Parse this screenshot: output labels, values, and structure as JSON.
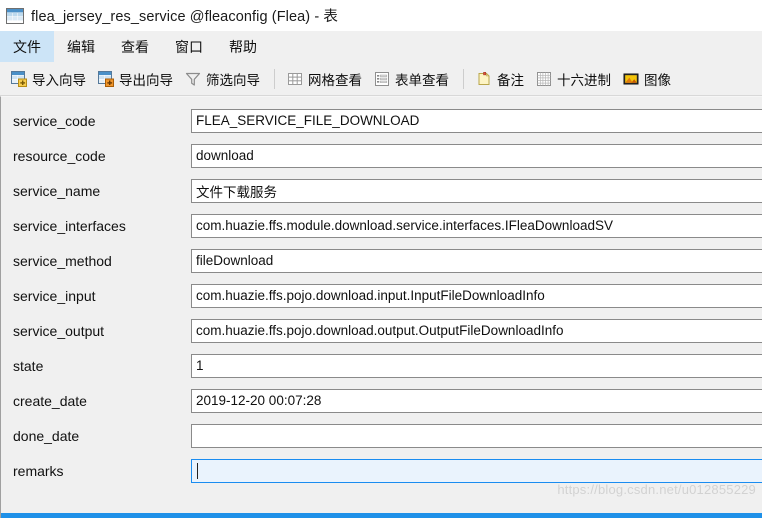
{
  "window": {
    "title": "flea_jersey_res_service @fleaconfig (Flea) - 表",
    "icon": "table-icon"
  },
  "menubar": {
    "items": [
      {
        "label": "文件",
        "active": true
      },
      {
        "label": "编辑",
        "active": false
      },
      {
        "label": "查看",
        "active": false
      },
      {
        "label": "窗口",
        "active": false
      },
      {
        "label": "帮助",
        "active": false
      }
    ]
  },
  "toolbar": {
    "groups": [
      {
        "buttons": [
          {
            "label": "导入向导",
            "icon": "import-wizard-icon"
          },
          {
            "label": "导出向导",
            "icon": "export-wizard-icon"
          },
          {
            "label": "筛选向导",
            "icon": "filter-wizard-icon"
          }
        ]
      },
      {
        "buttons": [
          {
            "label": "网格查看",
            "icon": "grid-view-icon"
          },
          {
            "label": "表单查看",
            "icon": "form-view-icon"
          }
        ]
      },
      {
        "buttons": [
          {
            "label": "备注",
            "icon": "memo-icon"
          },
          {
            "label": "十六进制",
            "icon": "hex-icon"
          },
          {
            "label": "图像",
            "icon": "image-icon"
          }
        ]
      }
    ]
  },
  "form": {
    "fields": [
      {
        "label": "service_code",
        "value": "FLEA_SERVICE_FILE_DOWNLOAD",
        "focused": false
      },
      {
        "label": "resource_code",
        "value": "download",
        "focused": false
      },
      {
        "label": "service_name",
        "value": "文件下载服务",
        "focused": false
      },
      {
        "label": "service_interfaces",
        "value": "com.huazie.ffs.module.download.service.interfaces.IFleaDownloadSV",
        "focused": false
      },
      {
        "label": "service_method",
        "value": "fileDownload",
        "focused": false
      },
      {
        "label": "service_input",
        "value": "com.huazie.ffs.pojo.download.input.InputFileDownloadInfo",
        "focused": false
      },
      {
        "label": "service_output",
        "value": "com.huazie.ffs.pojo.download.output.OutputFileDownloadInfo",
        "focused": false
      },
      {
        "label": "state",
        "value": "1",
        "focused": false
      },
      {
        "label": "create_date",
        "value": "2019-12-20 00:07:28",
        "focused": false
      },
      {
        "label": "done_date",
        "value": "",
        "focused": false
      },
      {
        "label": "remarks",
        "value": "",
        "focused": true
      }
    ]
  },
  "watermark": {
    "text": "https://blog.csdn.net/u012855229"
  },
  "colors": {
    "accent": "#1e90e8",
    "menu_highlight": "#cce4f7",
    "chrome": "#f0f0f0",
    "focus_border": "#1a8cf0",
    "focus_bg": "#eaf3fd"
  }
}
